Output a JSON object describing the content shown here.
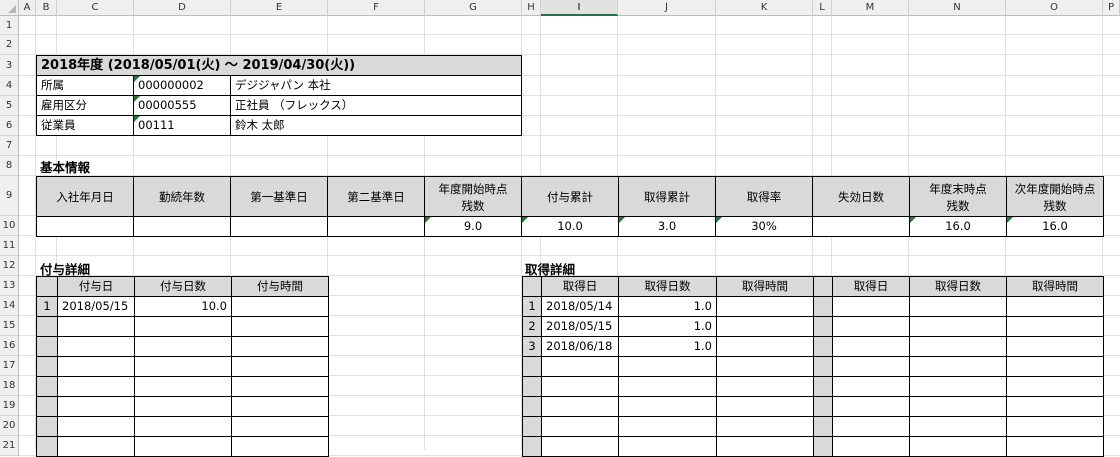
{
  "column_headers": [
    "A",
    "B",
    "C",
    "D",
    "E",
    "F",
    "G",
    "H",
    "I",
    "J",
    "K",
    "L",
    "M",
    "N",
    "O",
    "P"
  ],
  "row_headers": [
    "1",
    "2",
    "3",
    "4",
    "5",
    "6",
    "7",
    "8",
    "9",
    "10",
    "11",
    "12",
    "13",
    "14",
    "15",
    "16",
    "17",
    "18",
    "19",
    "20",
    "21"
  ],
  "period": {
    "title": "2018年度 (2018/05/01(火) ～ 2019/04/30(火))",
    "rows": [
      {
        "label": "所属",
        "code": "000000002",
        "value": "デジジャパン  本社"
      },
      {
        "label": "雇用区分",
        "code": "00000555",
        "value": "正社員 （フレックス）"
      },
      {
        "label": "従業員",
        "code": "00111",
        "value": "鈴木 太郎"
      }
    ]
  },
  "basic_info": {
    "title": "基本情報",
    "headers": [
      "入社年月日",
      "勤続年数",
      "第一基準日",
      "第二基準日",
      "年度開始時点\n残数",
      "付与累計",
      "取得累計",
      "取得率",
      "失効日数",
      "年度末時点\n残数",
      "次年度開始時点\n残数"
    ],
    "values": [
      "",
      "",
      "",
      "",
      "9.0",
      "10.0",
      "3.0",
      "30%",
      "",
      "16.0",
      "16.0"
    ]
  },
  "grant_details": {
    "title": "付与詳細",
    "headers": [
      "付与日",
      "付与日数",
      "付与時間"
    ],
    "rows": [
      {
        "no": "1",
        "date": "2018/05/15",
        "days": "10.0",
        "time": ""
      }
    ]
  },
  "acquisition_details": {
    "title": "取得詳細",
    "headers": [
      "取得日",
      "取得日数",
      "取得時間"
    ],
    "headers2": [
      "取得日",
      "取得日数",
      "取得時間"
    ],
    "rows": [
      {
        "no": "1",
        "date": "2018/05/14",
        "days": "1.0",
        "time": ""
      },
      {
        "no": "2",
        "date": "2018/05/15",
        "days": "1.0",
        "time": ""
      },
      {
        "no": "3",
        "date": "2018/06/18",
        "days": "1.0",
        "time": ""
      }
    ]
  }
}
